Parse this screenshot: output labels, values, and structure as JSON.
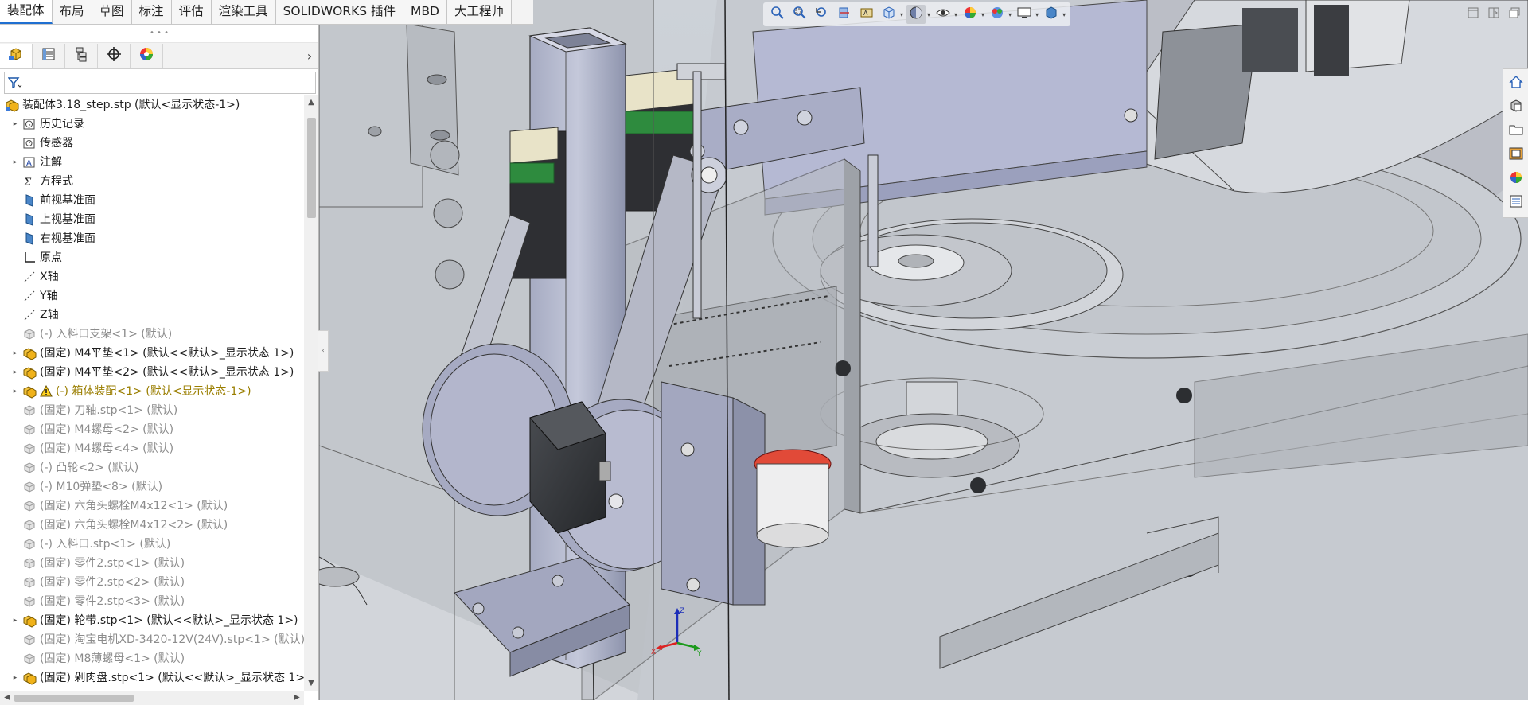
{
  "command_tabs": [
    {
      "label": "装配体",
      "active": true
    },
    {
      "label": "布局",
      "active": false
    },
    {
      "label": "草图",
      "active": false
    },
    {
      "label": "标注",
      "active": false
    },
    {
      "label": "评估",
      "active": false
    },
    {
      "label": "渲染工具",
      "active": false
    },
    {
      "label": "SOLIDWORKS 插件",
      "active": false
    },
    {
      "label": "MBD",
      "active": false
    },
    {
      "label": "大工程师",
      "active": false
    }
  ],
  "panel_tabs": [
    {
      "icon": "featuremanager-tree-icon"
    },
    {
      "icon": "property-manager-icon"
    },
    {
      "icon": "configuration-manager-icon"
    },
    {
      "icon": "dimxpert-manager-icon"
    },
    {
      "icon": "display-manager-icon"
    }
  ],
  "filter": {
    "placeholder": "",
    "icon": "filter-icon"
  },
  "tree": {
    "root": {
      "label": "装配体3.18_step.stp  (默认<显示状态-1>)"
    },
    "items": [
      {
        "label": "历史记录",
        "icon": "history-folder-icon",
        "expandable": true,
        "state": "normal"
      },
      {
        "label": "传感器",
        "icon": "sensor-icon",
        "expandable": false,
        "state": "normal"
      },
      {
        "label": "注解",
        "icon": "annotation-icon",
        "expandable": true,
        "state": "normal"
      },
      {
        "label": "方程式",
        "icon": "equation-icon",
        "expandable": false,
        "state": "normal"
      },
      {
        "label": "前视基准面",
        "icon": "plane-icon",
        "expandable": false,
        "state": "normal"
      },
      {
        "label": "上视基准面",
        "icon": "plane-icon",
        "expandable": false,
        "state": "normal"
      },
      {
        "label": "右视基准面",
        "icon": "plane-icon",
        "expandable": false,
        "state": "normal"
      },
      {
        "label": "原点",
        "icon": "origin-icon",
        "expandable": false,
        "state": "normal"
      },
      {
        "label": "X轴",
        "icon": "axis-icon",
        "expandable": false,
        "state": "normal"
      },
      {
        "label": "Y轴",
        "icon": "axis-icon",
        "expandable": false,
        "state": "normal"
      },
      {
        "label": "Z轴",
        "icon": "axis-icon",
        "expandable": false,
        "state": "normal"
      },
      {
        "label": "(-) 入料口支架<1> (默认)",
        "icon": "part-icon",
        "expandable": false,
        "state": "dim"
      },
      {
        "label": "(固定) M4平垫<1> (默认<<默认>_显示状态 1>)",
        "icon": "subassembly-icon",
        "expandable": true,
        "state": "normal"
      },
      {
        "label": "(固定) M4平垫<2> (默认<<默认>_显示状态 1>)",
        "icon": "subassembly-icon",
        "expandable": true,
        "state": "normal"
      },
      {
        "label": "(-) 箱体装配<1> (默认<显示状态-1>)",
        "icon": "subassembly-icon",
        "expandable": true,
        "state": "warn",
        "warning": true
      },
      {
        "label": "(固定) 刀轴.stp<1> (默认)",
        "icon": "part-icon",
        "expandable": false,
        "state": "dim"
      },
      {
        "label": "(固定) M4螺母<2> (默认)",
        "icon": "part-icon",
        "expandable": false,
        "state": "dim"
      },
      {
        "label": "(固定) M4螺母<4> (默认)",
        "icon": "part-icon",
        "expandable": false,
        "state": "dim"
      },
      {
        "label": "(-) 凸轮<2> (默认)",
        "icon": "part-icon",
        "expandable": false,
        "state": "dim"
      },
      {
        "label": "(-) M10弹垫<8> (默认)",
        "icon": "part-icon",
        "expandable": false,
        "state": "dim"
      },
      {
        "label": "(固定) 六角头螺栓M4x12<1> (默认)",
        "icon": "part-icon",
        "expandable": false,
        "state": "dim"
      },
      {
        "label": "(固定) 六角头螺栓M4x12<2> (默认)",
        "icon": "part-icon",
        "expandable": false,
        "state": "dim"
      },
      {
        "label": "(-) 入料口.stp<1> (默认)",
        "icon": "part-icon",
        "expandable": false,
        "state": "dim"
      },
      {
        "label": "(固定) 零件2.stp<1> (默认)",
        "icon": "part-icon",
        "expandable": false,
        "state": "dim"
      },
      {
        "label": "(固定) 零件2.stp<2> (默认)",
        "icon": "part-icon",
        "expandable": false,
        "state": "dim"
      },
      {
        "label": "(固定) 零件2.stp<3> (默认)",
        "icon": "part-icon",
        "expandable": false,
        "state": "dim"
      },
      {
        "label": "(固定) 轮带.stp<1> (默认<<默认>_显示状态 1>)",
        "icon": "subassembly-icon",
        "expandable": true,
        "state": "normal"
      },
      {
        "label": "(固定) 淘宝电机XD-3420-12V(24V).stp<1> (默认)",
        "icon": "part-icon",
        "expandable": false,
        "state": "dim"
      },
      {
        "label": "(固定) M8薄螺母<1> (默认)",
        "icon": "part-icon",
        "expandable": false,
        "state": "dim"
      },
      {
        "label": "(固定) 剁肉盘.stp<1> (默认<<默认>_显示状态 1>)",
        "icon": "subassembly-icon",
        "expandable": true,
        "state": "normal"
      }
    ]
  },
  "view_toolbar": [
    {
      "icon": "zoom-to-fit-icon"
    },
    {
      "icon": "zoom-to-area-icon"
    },
    {
      "icon": "previous-view-icon"
    },
    {
      "icon": "section-view-icon"
    },
    {
      "icon": "dynamic-annotation-icon"
    },
    {
      "icon": "view-orientation-icon"
    },
    {
      "icon": "display-style-icon"
    },
    {
      "icon": "hide-show-items-icon"
    },
    {
      "icon": "edit-appearance-icon"
    },
    {
      "icon": "apply-scene-icon"
    },
    {
      "icon": "view-settings-icon"
    },
    {
      "icon": "3d-view-icon"
    }
  ],
  "window_buttons": [
    {
      "icon": "restore-icon"
    },
    {
      "icon": "tile-icon"
    },
    {
      "icon": "maximize-icon"
    }
  ],
  "task_pane": [
    {
      "icon": "home-icon"
    },
    {
      "icon": "design-library-icon"
    },
    {
      "icon": "file-explorer-icon"
    },
    {
      "icon": "view-palette-icon"
    },
    {
      "icon": "appearances-icon"
    },
    {
      "icon": "custom-properties-icon"
    }
  ],
  "triad": {
    "x": "X",
    "y": "Y",
    "z": "Z"
  },
  "colors": {
    "accent": "#1f6fd1",
    "warning": "#9a7e00",
    "dim_text": "#8c8c8c",
    "rail_green": "#2e8b3e"
  }
}
